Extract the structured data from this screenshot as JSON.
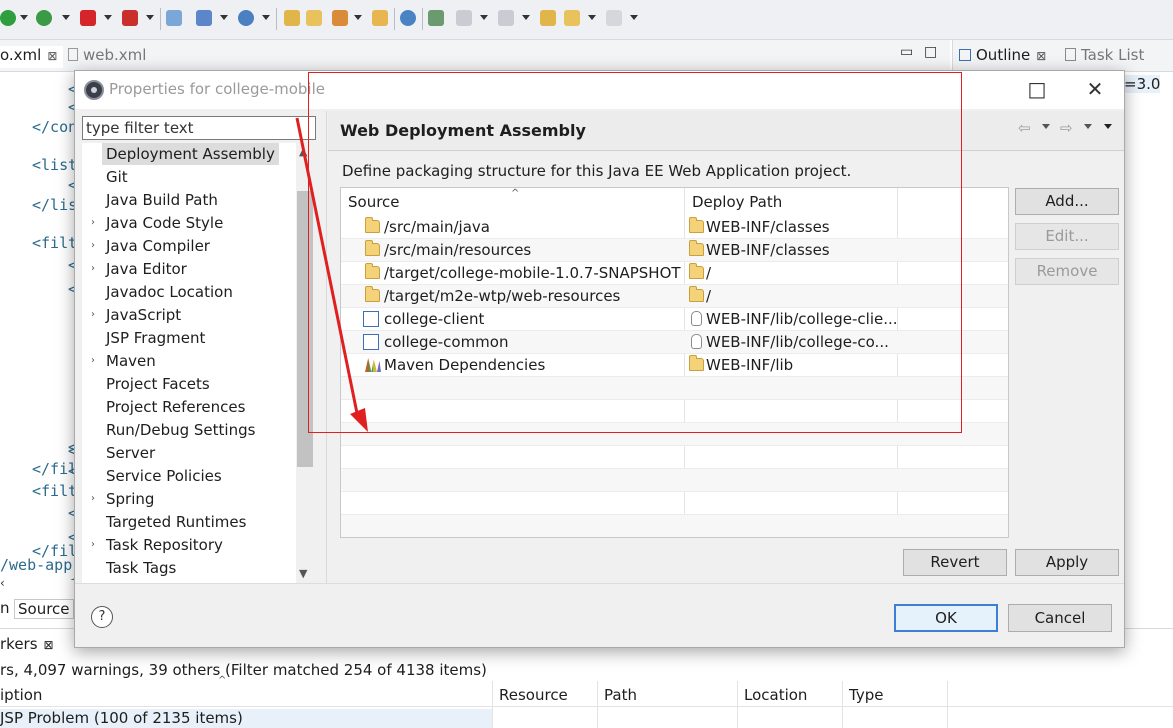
{
  "ide": {
    "editor_tabs": [
      {
        "label": "o.xml",
        "close": "⊠"
      },
      {
        "label": "web.xml",
        "close": ""
      }
    ],
    "outline_tabs": [
      {
        "label": "Outline",
        "close": "⊠"
      },
      {
        "label": "Task List",
        "close": ""
      }
    ],
    "outline_snippet": "=3.0",
    "code_lines": [
      "<",
      "<",
      "</con",
      "",
      "<list",
      "<",
      "</lis",
      "",
      "<filt",
      "<",
      "<",
      "",
      "",
      "",
      "<",
      "<",
      "",
      "",
      "",
      "<",
      "</fil",
      "<filt",
      "<",
      "<",
      "</fil",
      "/web-app",
      "<"
    ],
    "bottom_tabs": {
      "left": "n",
      "source": "Source"
    },
    "problems": {
      "tab_label": "rkers",
      "tab_close": "⊠",
      "summary": "rs, 4,097 warnings, 39 others (Filter matched 254 of 4138 items)",
      "columns": [
        "iption",
        "Resource",
        "Path",
        "Location",
        "Type"
      ],
      "first_row": "JSP Problem (100 of 2135 items)"
    }
  },
  "dialog": {
    "title": "Properties for college-mobile",
    "filter": {
      "placeholder": "type filter text",
      "value": ""
    },
    "nav_items": [
      {
        "label": "Deployment Assembly",
        "arrow": "",
        "selected": true
      },
      {
        "label": "Git",
        "arrow": ""
      },
      {
        "label": "Java Build Path",
        "arrow": ""
      },
      {
        "label": "Java Code Style",
        "arrow": "›"
      },
      {
        "label": "Java Compiler",
        "arrow": "›"
      },
      {
        "label": "Java Editor",
        "arrow": "›"
      },
      {
        "label": "Javadoc Location",
        "arrow": ""
      },
      {
        "label": "JavaScript",
        "arrow": "›"
      },
      {
        "label": "JSP Fragment",
        "arrow": ""
      },
      {
        "label": "Maven",
        "arrow": "›"
      },
      {
        "label": "Project Facets",
        "arrow": ""
      },
      {
        "label": "Project References",
        "arrow": ""
      },
      {
        "label": "Run/Debug Settings",
        "arrow": ""
      },
      {
        "label": "Server",
        "arrow": ""
      },
      {
        "label": "Service Policies",
        "arrow": ""
      },
      {
        "label": "Spring",
        "arrow": "›"
      },
      {
        "label": "Targeted Runtimes",
        "arrow": ""
      },
      {
        "label": "Task Repository",
        "arrow": "›"
      },
      {
        "label": "Task Tags",
        "arrow": ""
      }
    ],
    "page_title": "Web Deployment Assembly",
    "description": "Define packaging structure for this Java EE Web Application project.",
    "table": {
      "columns": [
        "Source",
        "Deploy Path"
      ],
      "rows": [
        {
          "source": "/src/main/java",
          "source_icon": "folder-icon",
          "deploy": "WEB-INF/classes",
          "deploy_icon": "folder-icon"
        },
        {
          "source": "/src/main/resources",
          "source_icon": "folder-icon",
          "deploy": "WEB-INF/classes",
          "deploy_icon": "folder-icon"
        },
        {
          "source": "/target/college-mobile-1.0.7-SNAPSHOT",
          "source_icon": "folder-icon",
          "deploy": "/",
          "deploy_icon": "folder-icon"
        },
        {
          "source": "/target/m2e-wtp/web-resources",
          "source_icon": "folder-icon",
          "deploy": "/",
          "deploy_icon": "folder-icon"
        },
        {
          "source": "college-client",
          "source_icon": "maven-project-icon",
          "deploy": "WEB-INF/lib/college-clie...",
          "deploy_icon": "jar-icon"
        },
        {
          "source": "college-common",
          "source_icon": "maven-project-icon",
          "deploy": "WEB-INF/lib/college-co...",
          "deploy_icon": "jar-icon"
        },
        {
          "source": "Maven Dependencies",
          "source_icon": "library-icon",
          "deploy": "WEB-INF/lib",
          "deploy_icon": "folder-icon"
        }
      ]
    },
    "buttons": {
      "add": "Add...",
      "edit": "Edit...",
      "remove": "Remove",
      "revert": "Revert",
      "apply": "Apply",
      "ok": "OK",
      "cancel": "Cancel",
      "help": "?"
    },
    "colors": {
      "annotation": "#e02020",
      "default_button_border": "#3c7fd5"
    }
  }
}
